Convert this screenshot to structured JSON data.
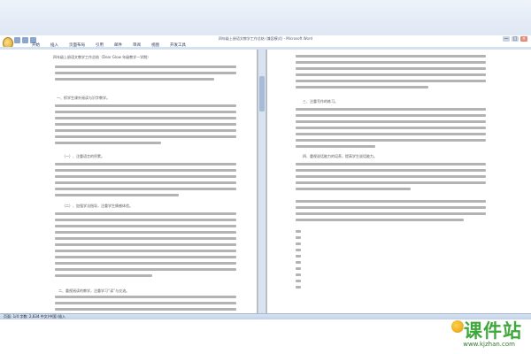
{
  "window": {
    "title": "四年级上册语文教学工作总结 (兼容模式) - Microsoft Word",
    "minimize": "—",
    "maximize": "□",
    "close": "×"
  },
  "ribbon": {
    "tabs": [
      "开始",
      "插入",
      "页面布局",
      "引用",
      "邮件",
      "审阅",
      "视图",
      "开发工具"
    ]
  },
  "document": {
    "title": "四年级上册语文教学工作总结（Dear Glow 年级教学一学期）",
    "left_headings": [
      "一、抓学生课外阅读与识字教学。",
      "（一）、注重语言的积累。",
      "（二）、加强学法指导，注重学生情感体验。",
      "二、重视阅读的教学，注重学习“读”与交流。"
    ],
    "right_headings": [
      "三、注重写作的练习。",
      "四、重视说话能力的培养，提高学生说话能力。"
    ]
  },
  "statusbar": {
    "text": "页面: 1/4   字数: 2,634   中文(中国)   插入"
  },
  "watermark": {
    "logo": "课件站",
    "url": "www.kjzhan.com"
  }
}
